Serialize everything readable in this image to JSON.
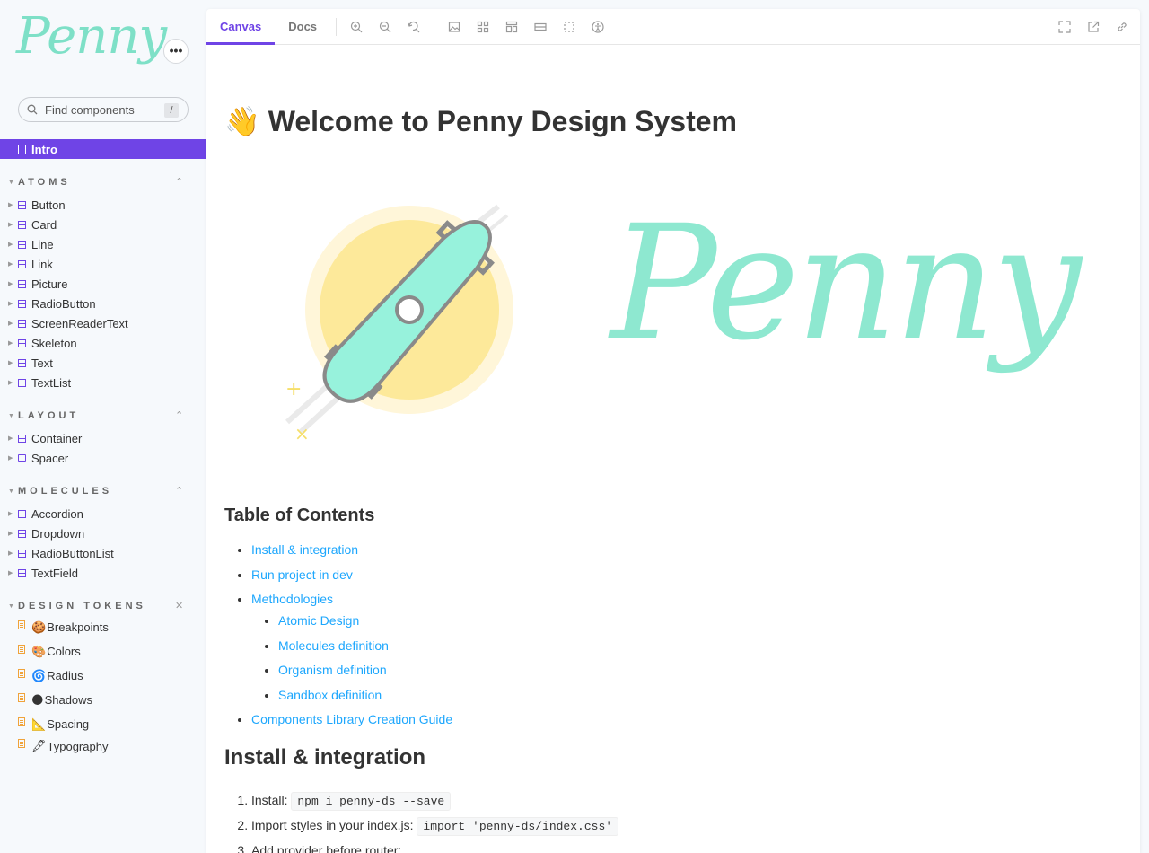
{
  "sidebar": {
    "logo": "Penny",
    "menu_label": "•••",
    "search": {
      "placeholder": "Find components",
      "shortcut": "/"
    },
    "intro": "Intro",
    "sections": [
      {
        "title": "ATOMS",
        "items": [
          "Button",
          "Card",
          "Line",
          "Link",
          "Picture",
          "RadioButton",
          "ScreenReaderText",
          "Skeleton",
          "Text",
          "TextList"
        ]
      },
      {
        "title": "LAYOUT",
        "items": [
          "Container",
          "Spacer"
        ]
      },
      {
        "title": "MOLECULES",
        "items": [
          "Accordion",
          "Dropdown",
          "RadioButtonList",
          "TextField"
        ]
      },
      {
        "title": "DESIGN TOKENS",
        "items": [
          {
            "emoji": "🍪",
            "label": "Breakpoints"
          },
          {
            "emoji": "🎨",
            "label": "Colors"
          },
          {
            "emoji": "🌀",
            "label": "Radius"
          },
          {
            "emoji": "🌑",
            "label": "Shadows"
          },
          {
            "emoji": "📐",
            "label": "Spacing"
          },
          {
            "emoji": "🖋",
            "label": "Typography"
          }
        ]
      }
    ]
  },
  "toolbar": {
    "tabs": [
      "Canvas",
      "Docs"
    ],
    "active_tab": "Canvas",
    "tools": [
      "zoom-in-icon",
      "zoom-out-icon",
      "zoom-reset-icon",
      "background-icon",
      "grid-icon",
      "viewport-icon",
      "measure-icon",
      "outline-icon",
      "accessibility-icon"
    ],
    "right_tools": [
      "fullscreen-icon",
      "open-new-tab-icon",
      "copy-link-icon"
    ]
  },
  "content": {
    "title_emoji": "👋",
    "title": "Welcome to Penny Design System",
    "hero_word": "Penny",
    "toc_title": "Table of Contents",
    "toc": [
      "Install & integration",
      "Run project in dev",
      "Methodologies",
      "Components Library Creation Guide"
    ],
    "toc_sub": [
      "Atomic Design",
      "Molecules definition",
      "Organism definition",
      "Sandbox definition"
    ],
    "install_title": "Install & integration",
    "steps": [
      {
        "text": "Install:",
        "code": "npm i penny-ds --save"
      },
      {
        "text": "Import styles in your index.js:",
        "code": "import 'penny-ds/index.css'"
      },
      {
        "text": "Add provider before router:",
        "code": ""
      }
    ]
  },
  "colors": {
    "accent": "#6f44e6",
    "link": "#1ea7fd",
    "mint": "#8ee8d0",
    "sun": "#fde99a"
  }
}
